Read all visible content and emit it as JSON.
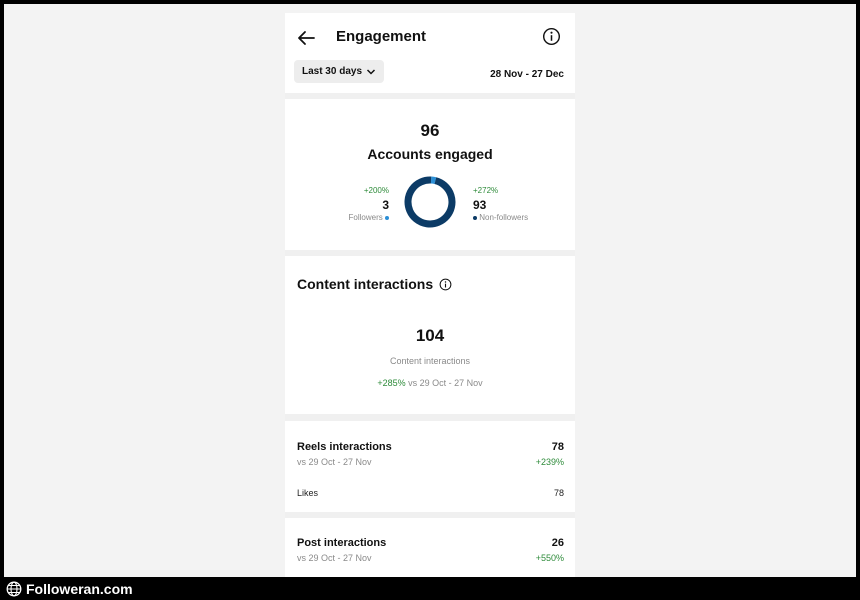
{
  "header": {
    "title": "Engagement",
    "range_button": "Last 30 days",
    "date_range": "28 Nov - 27 Dec"
  },
  "accounts": {
    "total": "96",
    "label": "Accounts engaged",
    "followers": {
      "pct": "+200%",
      "count": "3",
      "label": "Followers"
    },
    "non_followers": {
      "pct": "+272%",
      "count": "93",
      "label": "Non-followers"
    }
  },
  "content": {
    "title": "Content interactions",
    "total": "104",
    "label": "Content interactions",
    "change": "+285%",
    "compare": " vs 29 Oct - 27 Nov"
  },
  "reels": {
    "title": "Reels interactions",
    "value": "78",
    "compare": "vs 29 Oct - 27 Nov",
    "change": "+239%",
    "likes_label": "Likes",
    "likes_value": "78"
  },
  "posts": {
    "title": "Post interactions",
    "value": "26",
    "compare": "vs 29 Oct - 27 Nov",
    "change": "+550%"
  },
  "chart_data": {
    "type": "pie",
    "categories": [
      "Followers",
      "Non-followers"
    ],
    "values": [
      3,
      93
    ],
    "colors": [
      "#2b8fd6",
      "#0c3b66"
    ]
  },
  "watermark": "Followeran.com",
  "colors": {
    "positive": "#2e8b3a",
    "donut_followers": "#2b8fd6",
    "donut_nonfollowers": "#0c3b66"
  },
  "icons": {
    "back": "arrow-left-icon",
    "info": "info-icon",
    "dropdown": "chevron-down-icon",
    "globe": "globe-icon"
  }
}
